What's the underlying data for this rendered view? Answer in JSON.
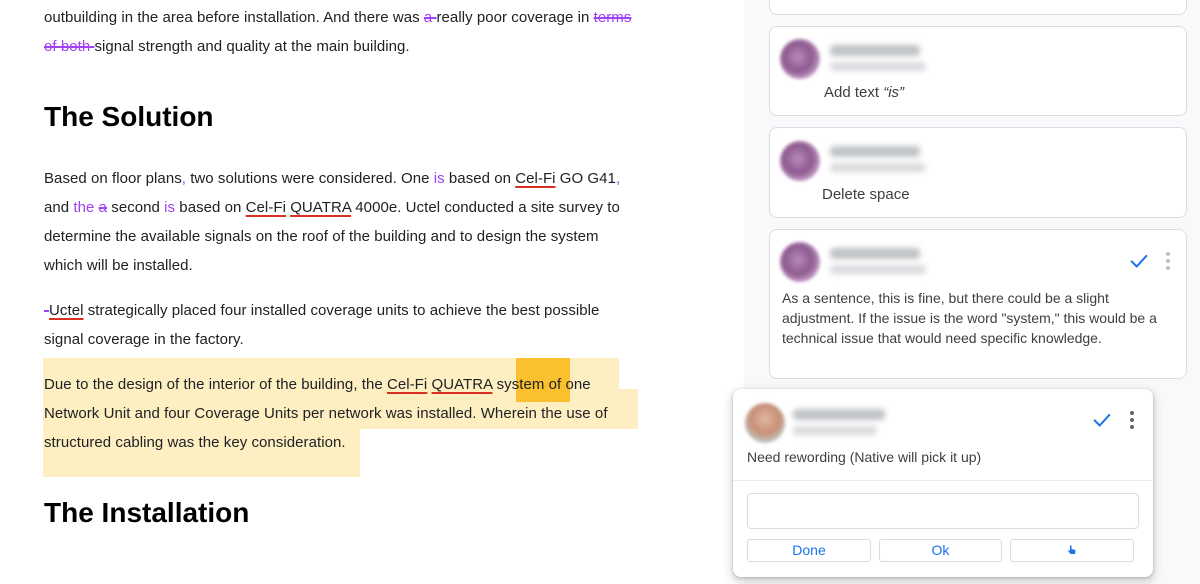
{
  "document": {
    "para1": {
      "line1": {
        "a": "outbuilding in the area before installation. And there was ",
        "del1": "a ",
        "b": "really poor coverage in ",
        "del2": "terms"
      },
      "line2": {
        "del": "of both ",
        "a": "signal strength and quality at the main building."
      }
    },
    "heading_solution": "The Solution",
    "para2": {
      "line1": {
        "a": "Based on floor plans",
        "ins1": ",",
        "b": " two solutions were considered.  One ",
        "ins2": "is",
        "c": " based on ",
        "spell1": "Cel-Fi",
        "d": " GO G41",
        "ins3": ","
      },
      "line2": {
        "a": "and ",
        "ins1": "the",
        "b": " ",
        "del": "a",
        "c": " second ",
        "ins2": "is",
        "d": " based on ",
        "spell1": "Cel-Fi",
        "e": " ",
        "spell2": "QUATRA",
        "f": " 4000e.  Uctel conducted a site survey to"
      },
      "line3": "determine the available signals on the roof of the building and to design the system",
      "line4": "which will be installed."
    },
    "para3": {
      "line1": {
        "del": "-",
        "spell": "Uctel",
        "a": " strategically placed four installed coverage units to achieve the best possible"
      },
      "line2": "signal coverage in the factory."
    },
    "para4": {
      "line1": {
        "a": "Due to the design of the interior of the building, the ",
        "spell1": "Cel-Fi",
        "b": " ",
        "spell2": "QUATRA",
        "c": " ",
        "hl": "system",
        "d": " of one"
      },
      "line2": "Network Unit and four Coverage Units per network was installed. Wherein the use of",
      "line3": "structured cabling was the key consideration."
    },
    "heading_installation": "The Installation"
  },
  "comments": [
    {
      "text_a": "Add text ",
      "text_b": "“is”"
    },
    {
      "text": "Delete space"
    },
    {
      "lines": [
        "As a sentence, this is fine, but there could be a slight",
        "adjustment. If the issue is the word \"system,\" this would be a",
        "technical issue that would need specific knowledge."
      ],
      "icons": [
        "check-icon",
        "more-vert-icon"
      ]
    }
  ],
  "active_comment": {
    "text": "Need rewording (Native will pick it up)",
    "reply_placeholder": "",
    "buttons": {
      "done": "Done",
      "ok": "Ok"
    },
    "icons": [
      "check-icon",
      "more-vert-icon",
      "pointer-icon"
    ]
  },
  "colors": {
    "suggestion": "#a142f4",
    "spelling": "#d93025",
    "highlight": "#feefc3",
    "highlight_active": "#fbc02d",
    "accent": "#1a73e8"
  }
}
